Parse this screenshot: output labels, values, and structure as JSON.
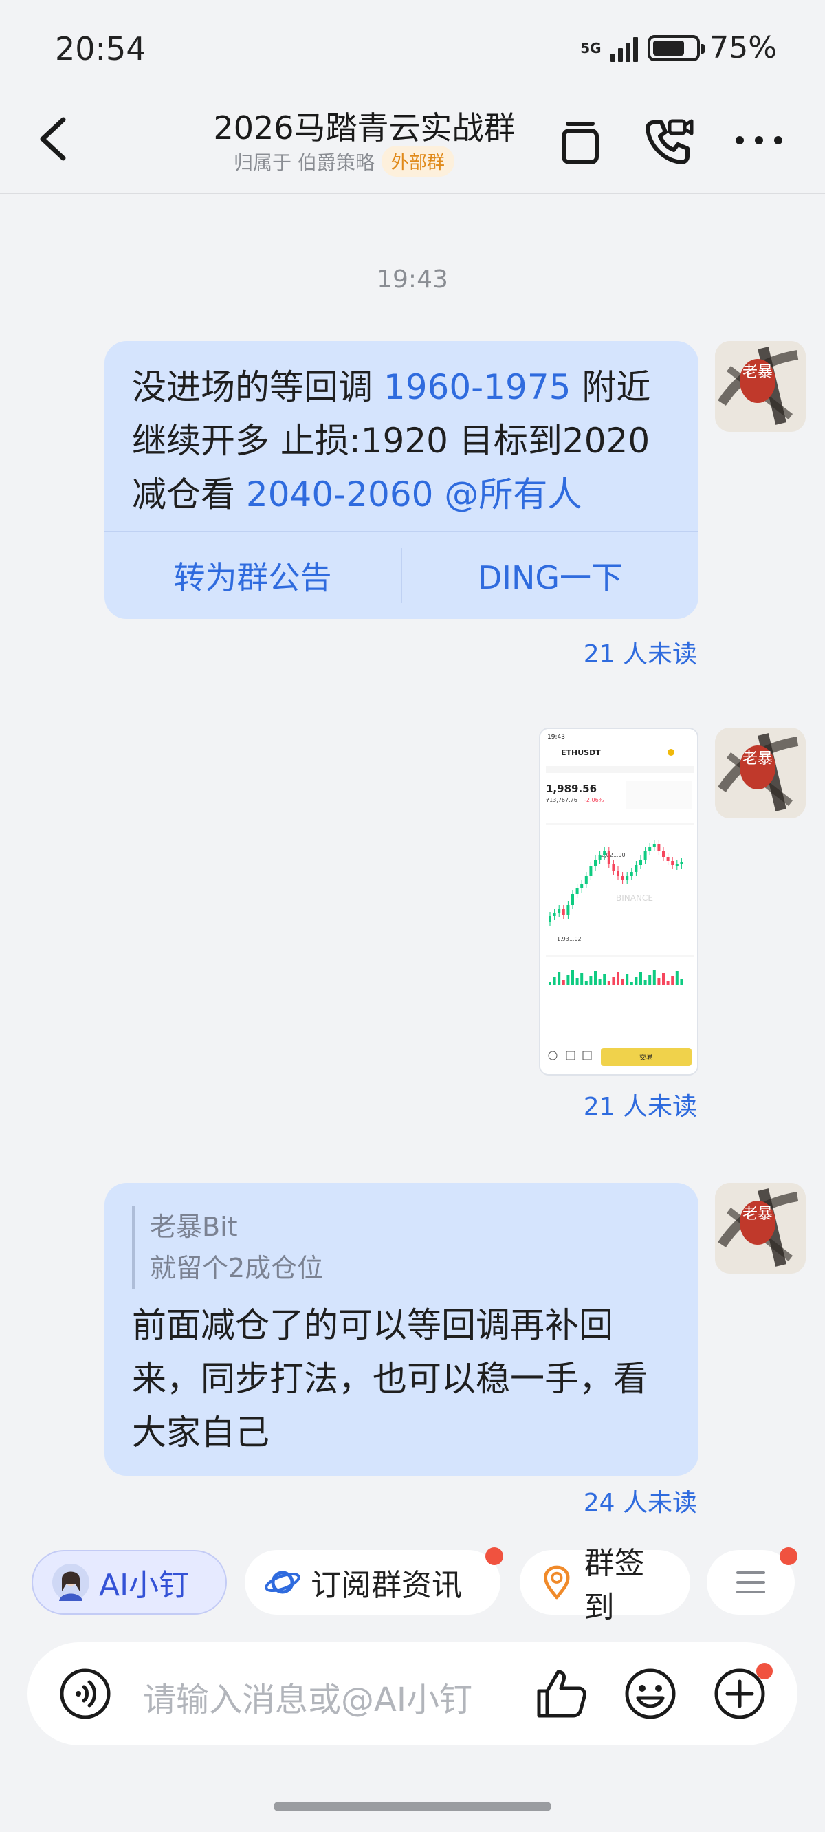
{
  "status": {
    "time": "20:54",
    "network": "5G",
    "battery": "75%",
    "battery_level": 0.75
  },
  "header": {
    "title": "2026马踏青云实战群",
    "subtitle_prefix": "归属于 伯爵策略",
    "tag": "外部群"
  },
  "messages": [
    {
      "timestamp": "19:43",
      "segments": [
        {
          "text": "没进场的等回调 "
        },
        {
          "text": "1960-1975",
          "link": true
        },
        {
          "text": " 附近继续开多 止损:1920 目标到2020减仓看 "
        },
        {
          "text": "2040-2060",
          "link": true
        },
        {
          "text": " "
        },
        {
          "text": "@所有人",
          "link": true
        }
      ],
      "actions": [
        "转为群公告",
        "DING一下"
      ],
      "unread": "21 人未读",
      "avatar_text": "老暴"
    },
    {
      "type": "image",
      "image": {
        "time": "19:43",
        "pair": "ETHUSDT",
        "price": "1,989.56",
        "sub_price": "¥13,767.76",
        "change": "-2.06%",
        "label_high": "2,021.90",
        "label_low": "1,931.02",
        "watermark": "BINANCE",
        "trade_btn": "交易"
      },
      "unread": "21 人未读",
      "avatar_text": "老暴"
    },
    {
      "quote_author": "老暴Bit",
      "quote_text": "就留个2成仓位",
      "text": "前面减仓了的可以等回调再补回来，同步打法，也可以稳一手，看大家自己",
      "unread": "24 人未读",
      "avatar_text": "老暴"
    }
  ],
  "quick_actions": [
    "AI小钉",
    "订阅群资讯",
    "群签到"
  ],
  "input": {
    "placeholder": "请输入消息或@AI小钉"
  },
  "colors": {
    "bubble": "#d5e4fd",
    "link": "#2f6bde",
    "badge": "#f0523f",
    "tag_bg": "#fdf0dc",
    "tag_fg": "#e08a1a"
  }
}
